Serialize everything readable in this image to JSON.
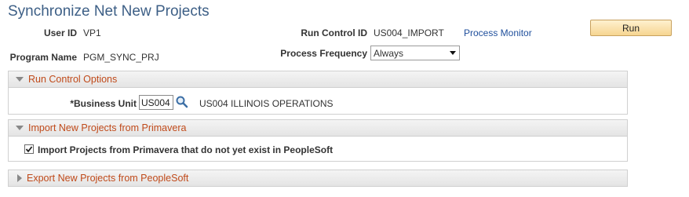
{
  "page": {
    "title": "Synchronize Net New Projects"
  },
  "header": {
    "user_id_label": "User ID",
    "user_id_value": "VP1",
    "run_control_label": "Run Control ID",
    "run_control_value": "US004_IMPORT",
    "process_monitor_link": "Process Monitor",
    "run_button": "Run",
    "program_name_label": "Program Name",
    "program_name_value": "PGM_SYNC_PRJ",
    "process_frequency_label": "Process Frequency",
    "process_frequency_value": "Always"
  },
  "sections": {
    "run_control": {
      "title": "Run Control Options",
      "business_unit_label": "*Business Unit",
      "business_unit_value": "US004",
      "business_unit_description": "US004 ILLINOIS OPERATIONS"
    },
    "import": {
      "title": "Import New Projects from Primavera",
      "checkbox_label": "Import Projects from Primavera that do not yet exist in PeopleSoft",
      "checked": true
    },
    "export": {
      "title": "Export New Projects from PeopleSoft"
    }
  },
  "colors": {
    "title": "#3d5f86",
    "section_title": "#c04a1a",
    "link": "#1f4f9c",
    "button": "#f6d591"
  },
  "icons": {
    "lookup": "magnifier-icon",
    "checkbox": "check-icon"
  }
}
